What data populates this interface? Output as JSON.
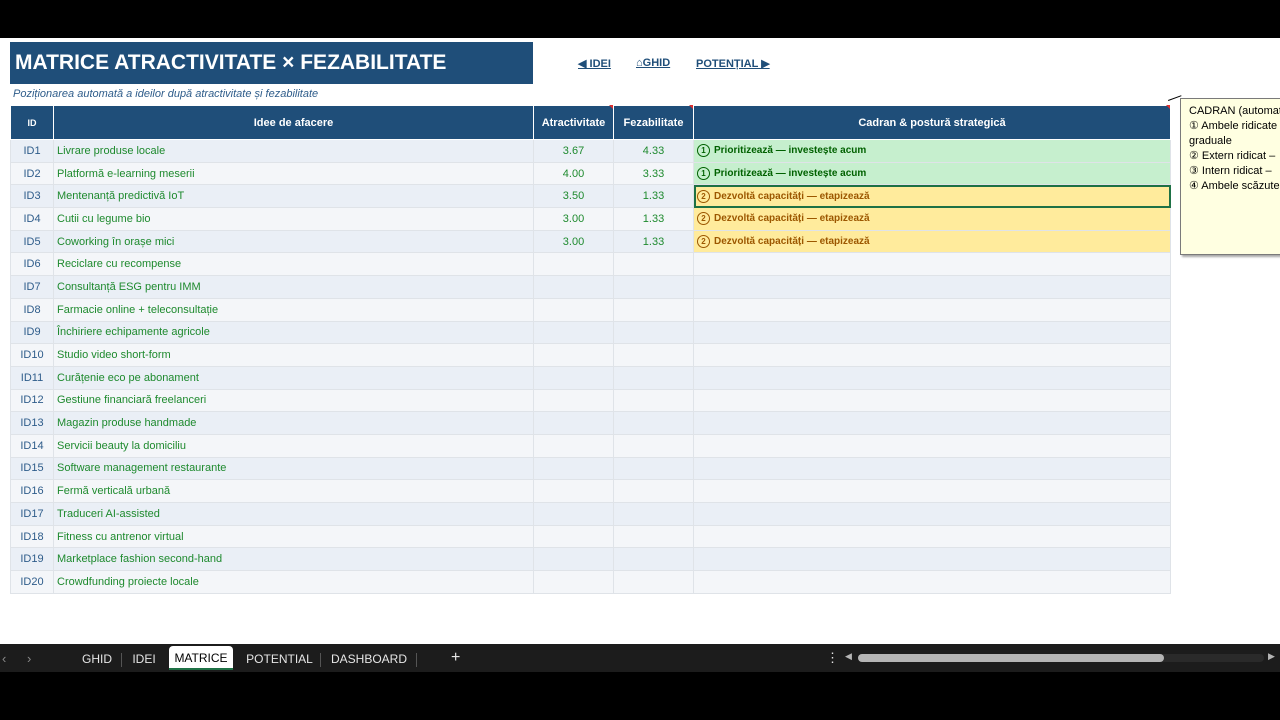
{
  "title": "MATRICE ATRACTIVITATE × FEZABILITATE",
  "subtitle": "Poziționarea automată a ideilor după atractivitate și fezabilitate",
  "nav_links": [
    {
      "label": "◀ IDEI"
    },
    {
      "label": "⌂GHID"
    },
    {
      "label": "POTENȚIAL ▶"
    }
  ],
  "table": {
    "headers": {
      "id": "ID",
      "idea": "Idee de afacere",
      "attractiveness": "Atractivitate",
      "feasibility": "Fezabilitate",
      "quadrant": "Cadran & postură strategică"
    },
    "rows": [
      {
        "id": "ID1",
        "idea": "Livrare produse locale",
        "atr": "3.67",
        "fez": "4.33",
        "qnum": "1",
        "quadrant": "Prioritizează — investește acum"
      },
      {
        "id": "ID2",
        "idea": "Platformă e-learning meserii",
        "atr": "4.00",
        "fez": "3.33",
        "qnum": "1",
        "quadrant": "Prioritizează — investește acum"
      },
      {
        "id": "ID3",
        "idea": "Mentenanță predictivă IoT",
        "atr": "3.50",
        "fez": "1.33",
        "qnum": "2",
        "quadrant": "Dezvoltă capacități — etapizează"
      },
      {
        "id": "ID4",
        "idea": "Cutii cu legume bio",
        "atr": "3.00",
        "fez": "1.33",
        "qnum": "2",
        "quadrant": "Dezvoltă capacități — etapizează"
      },
      {
        "id": "ID5",
        "idea": "Coworking în orașe mici",
        "atr": "3.00",
        "fez": "1.33",
        "qnum": "2",
        "quadrant": "Dezvoltă capacități — etapizează"
      },
      {
        "id": "ID6",
        "idea": "Reciclare cu recompense",
        "atr": "",
        "fez": "",
        "qnum": "",
        "quadrant": ""
      },
      {
        "id": "ID7",
        "idea": "Consultanță ESG pentru IMM",
        "atr": "",
        "fez": "",
        "qnum": "",
        "quadrant": ""
      },
      {
        "id": "ID8",
        "idea": "Farmacie online + teleconsultație",
        "atr": "",
        "fez": "",
        "qnum": "",
        "quadrant": ""
      },
      {
        "id": "ID9",
        "idea": "Închiriere echipamente agricole",
        "atr": "",
        "fez": "",
        "qnum": "",
        "quadrant": ""
      },
      {
        "id": "ID10",
        "idea": "Studio video short-form",
        "atr": "",
        "fez": "",
        "qnum": "",
        "quadrant": ""
      },
      {
        "id": "ID11",
        "idea": "Curățenie eco pe abonament",
        "atr": "",
        "fez": "",
        "qnum": "",
        "quadrant": ""
      },
      {
        "id": "ID12",
        "idea": "Gestiune financiară freelanceri",
        "atr": "",
        "fez": "",
        "qnum": "",
        "quadrant": ""
      },
      {
        "id": "ID13",
        "idea": "Magazin produse handmade",
        "atr": "",
        "fez": "",
        "qnum": "",
        "quadrant": ""
      },
      {
        "id": "ID14",
        "idea": "Servicii beauty la domiciliu",
        "atr": "",
        "fez": "",
        "qnum": "",
        "quadrant": ""
      },
      {
        "id": "ID15",
        "idea": "Software management restaurante",
        "atr": "",
        "fez": "",
        "qnum": "",
        "quadrant": ""
      },
      {
        "id": "ID16",
        "idea": "Fermă verticală urbană",
        "atr": "",
        "fez": "",
        "qnum": "",
        "quadrant": ""
      },
      {
        "id": "ID17",
        "idea": "Traduceri AI-assisted",
        "atr": "",
        "fez": "",
        "qnum": "",
        "quadrant": ""
      },
      {
        "id": "ID18",
        "idea": "Fitness cu antrenor virtual",
        "atr": "",
        "fez": "",
        "qnum": "",
        "quadrant": ""
      },
      {
        "id": "ID19",
        "idea": "Marketplace fashion second-hand",
        "atr": "",
        "fez": "",
        "qnum": "",
        "quadrant": ""
      },
      {
        "id": "ID20",
        "idea": "Crowdfunding proiecte locale",
        "atr": "",
        "fez": "",
        "qnum": "",
        "quadrant": ""
      }
    ]
  },
  "note": {
    "lines": [
      "CADRAN (automat",
      "① Ambele ridicate",
      "graduale",
      "② Extern ridicat –",
      "③ Intern ridicat –",
      "④ Ambele scăzute"
    ]
  },
  "sheet_tabs": [
    {
      "label": "GHID",
      "active": false
    },
    {
      "label": "IDEI",
      "active": false
    },
    {
      "label": "MATRICE",
      "active": true
    },
    {
      "label": "POTENTIAL",
      "active": false
    },
    {
      "label": "DASHBOARD",
      "active": false
    }
  ],
  "tabbar": {
    "prev_icon": "‹",
    "next_icon": "›",
    "add_icon": "+",
    "more_icon": "⋮",
    "scroll_left_icon": "◀",
    "scroll_right_icon": "▶"
  },
  "colors": {
    "header_blue": "#1f4e79",
    "quadrant1_fill": "#c6efce",
    "quadrant2_fill": "#ffeb9c",
    "idea_text_green": "#1e8a2e"
  }
}
